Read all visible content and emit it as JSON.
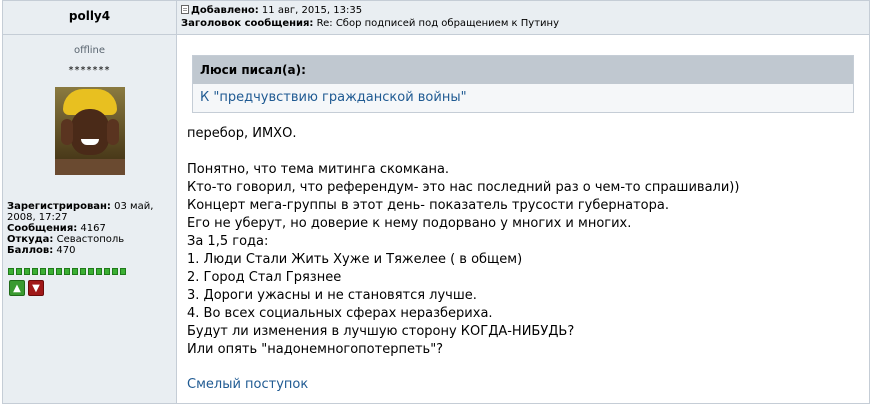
{
  "author": {
    "username": "polly4",
    "status": "offline",
    "rank_stars": "*******",
    "registered_label": "Зарегистрирован:",
    "registered_value": "03 май, 2008, 17:27",
    "posts_label": "Сообщения:",
    "posts_value": "4167",
    "from_label": "Откуда:",
    "from_value": "Севастополь",
    "points_label": "Баллов:",
    "points_value": "470",
    "reputation_pips": 15
  },
  "post_header": {
    "added_label": "Добавлено:",
    "added_value": "11 авг, 2015, 13:35",
    "subject_label": "Заголовок сообщения:",
    "subject_value": "Re: Сбор подписей под обращением к Путину"
  },
  "quote": {
    "header": "Люси писал(а):",
    "text": "К \"предчувствию гражданской войны\""
  },
  "message": {
    "lines": [
      "перебор, ИМХО.",
      "",
      "Понятно, что тема митинга скомкана.",
      "Кто-то говорил, что референдум- это нас последний раз о чем-то спрашивали))",
      "Концерт мега-группы в этот день- показатель трусости губернатора.",
      "Его не уберут, но доверие к нему подорвано у многих и многих.",
      "За 1,5 года:",
      "1. Люди Стали Жить Хуже и Тяжелее ( в общем)",
      "2. Город Стал Грязнее",
      "3. Дороги ужасны и не становятся лучше.",
      "4. Во всех социальных сферах неразбериха.",
      "Будут ли изменения в лучшую сторону КОГДА-НИБУДЬ?",
      "Или опять \"надонемногопотерпеть\"?"
    ]
  },
  "signature_link": "Смелый поступок",
  "colors": {
    "panel_bg": "#e9eef2",
    "border": "#c5cdd6",
    "quote_header_bg": "#c0c8d0",
    "link": "#1f5a92",
    "reputation_green": "#3cb034",
    "vote_up": "#3a9a30",
    "vote_down": "#a01818"
  }
}
